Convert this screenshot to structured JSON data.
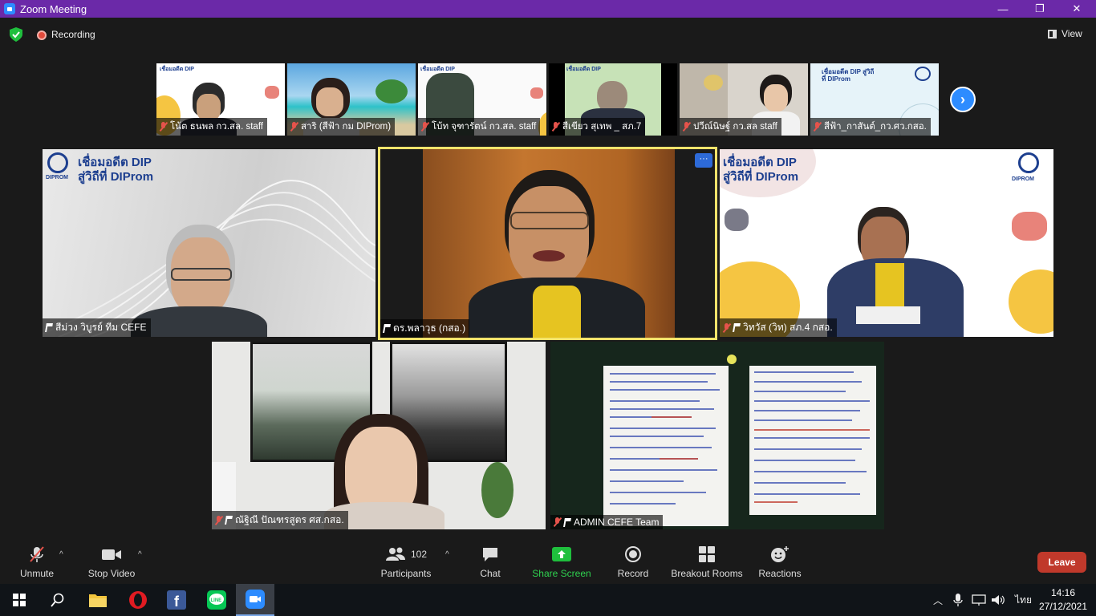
{
  "window": {
    "title": "Zoom Meeting",
    "minimize": "—",
    "restore": "❐",
    "close": "✕"
  },
  "topbar": {
    "recording_label": "Recording",
    "view_label": "View"
  },
  "gallery_strip": [
    {
      "name": "โน้ต ธนพล กว.สล. staff",
      "banner": "เชื่อมอดีต DIP"
    },
    {
      "name": "สาริ (สีฟ้า กม DIProm)"
    },
    {
      "name": "โบ้ท จุฑารัตน์ กว.สล. staff",
      "banner": "เชื่อมอดีต DIP"
    },
    {
      "name": "สีเขียว สุเทพ _ สภ.7",
      "banner": "เชื่อมอดีต DIP"
    },
    {
      "name": "ปวีณ์นิษฐ์ กว.สล staff"
    },
    {
      "name": "สีฟ้า_กาสันต์_กว.ศว.กสอ.",
      "banner": "เชื่อมอดีต DIP สู่วิถีที่ DIProm"
    }
  ],
  "main_tiles": [
    {
      "name": "สีม่วง วิบูรย์ ทีม CEFE",
      "banner_line1": "เชื่อมอดีต DIP",
      "banner_line2": "สู่วิถีที่ DIProm",
      "logo": "DIPROM"
    },
    {
      "name": "ดร.พลาวุธ (กสอ.)",
      "more": "···"
    },
    {
      "name": "วิทวัส (วิท) สภ.4 กสอ.",
      "banner_line1": "เชื่อมอดีต DIP",
      "banner_line2": "สู่วิถีที่ DIProm",
      "logo": "DIPROM"
    },
    {
      "name": "ณัฐิณี ปัณฑรสูตร ศส.กสอ."
    },
    {
      "name": "ADMIN CEFE Team"
    }
  ],
  "toolbar": {
    "unmute": "Unmute",
    "stop_video": "Stop Video",
    "participants": "Participants",
    "participants_count": "102",
    "chat": "Chat",
    "share_screen": "Share Screen",
    "record": "Record",
    "breakout_rooms": "Breakout Rooms",
    "reactions": "Reactions",
    "leave": "Leave",
    "caret": "^"
  },
  "taskbar": {
    "ime": "ไทย",
    "time": "14:16",
    "date": "27/12/2021"
  },
  "colors": {
    "titlebar": "#6b29a8",
    "accent": "#2d8cff",
    "active_speaker_border": "#f2e36b",
    "leave": "#c0392b",
    "share": "#1fbf3d"
  }
}
